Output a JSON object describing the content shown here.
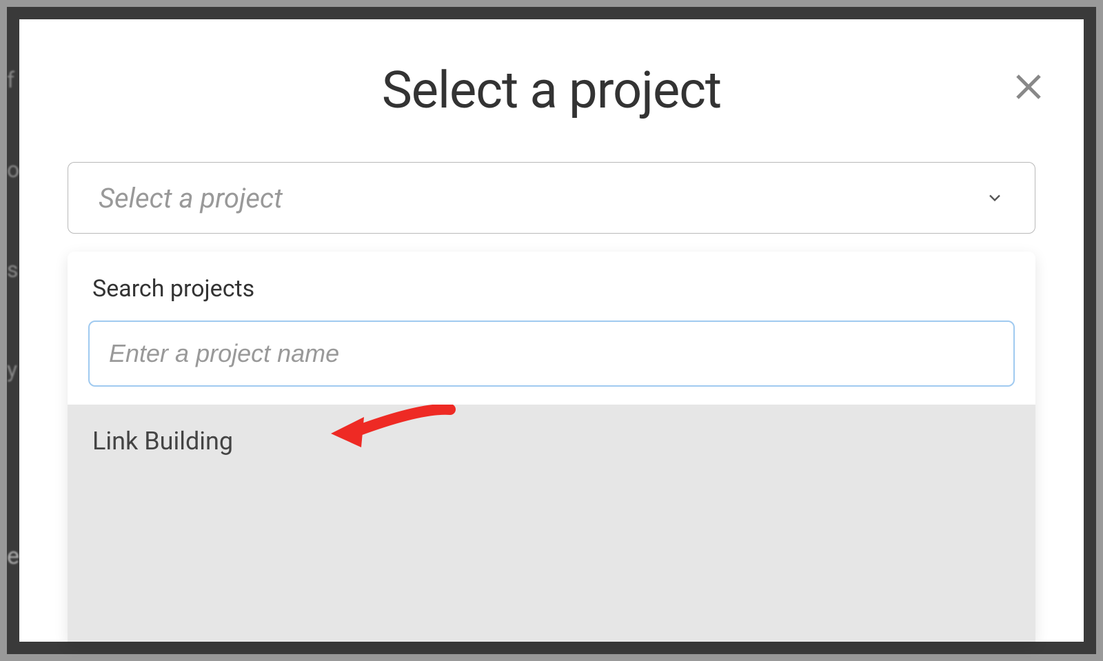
{
  "modal": {
    "title": "Select a project",
    "close_icon": "close-icon",
    "select": {
      "placeholder": "Select a project",
      "chevron_icon": "chevron-down-icon"
    },
    "dropdown": {
      "search_label": "Search projects",
      "search_placeholder": "Enter a project name",
      "search_value": "",
      "results": [
        {
          "label": "Link Building"
        }
      ]
    }
  },
  "annotation": {
    "arrow_color": "#ee2a24",
    "points_to": "result-item-link-building"
  },
  "background_fragments": [
    "f",
    "o",
    "s",
    "y",
    "eo"
  ]
}
